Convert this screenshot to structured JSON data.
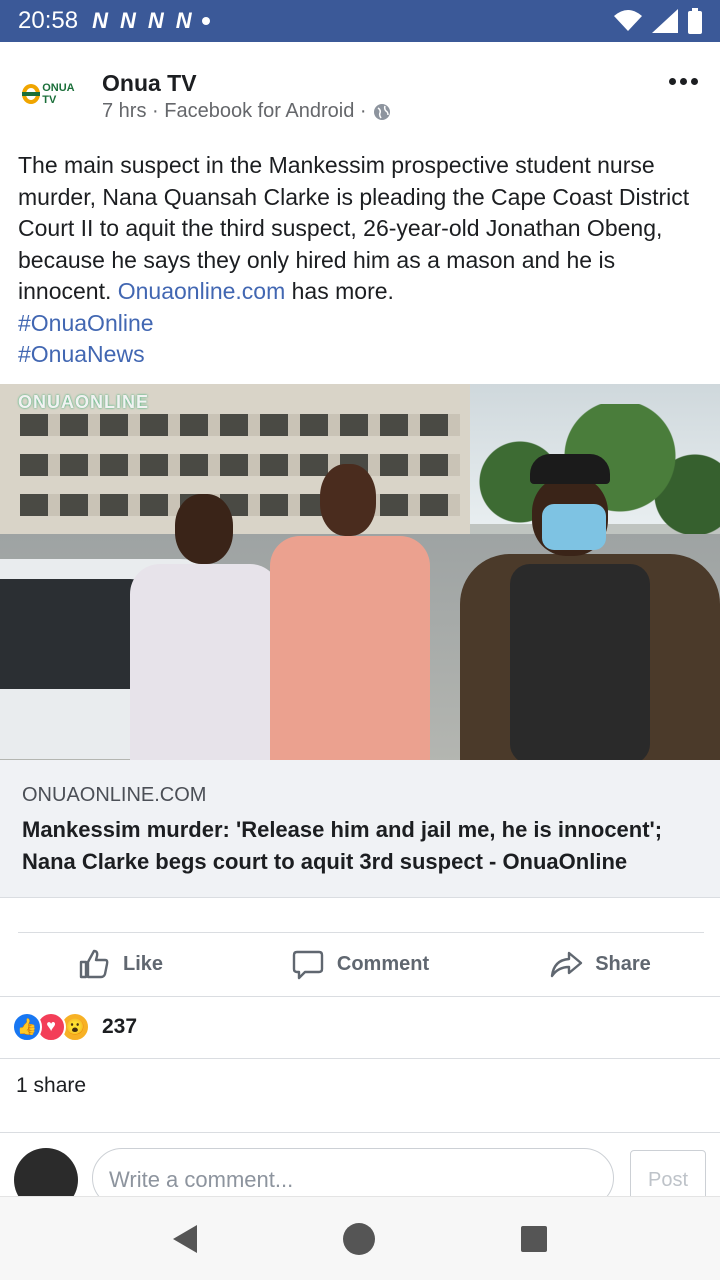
{
  "status_bar": {
    "time": "20:58",
    "notification_icons": [
      "N",
      "N",
      "N",
      "N"
    ],
    "icons": [
      "wifi-icon",
      "signal-icon",
      "battery-icon"
    ],
    "background": "#3b5998"
  },
  "post": {
    "page_name": "Onua TV",
    "logo_text": "ONUA TV",
    "meta": "7 hrs · Facebook for Android ·",
    "text_main": "The main suspect in the Mankessim prospective student nurse murder, Nana Quansah Clarke is pleading the Cape Coast District Court II to aquit the third suspect, 26-year-old Jonathan Obeng, because he says they only hired him as a mason and he is innocent. ",
    "text_link": "Onuaonline.com",
    "text_tail": " has more.",
    "hashtags": [
      "#OnuaOnline",
      "#OnuaNews"
    ],
    "image_watermark": "ONUAONLINE",
    "link_preview": {
      "domain": "ONUAONLINE.COM",
      "title": "Mankessim murder: 'Release him and jail me, he is innocent'; Nana Clarke begs court to aquit 3rd suspect - OnuaOnline"
    }
  },
  "actions": {
    "like": "Like",
    "comment": "Comment",
    "share": "Share"
  },
  "reactions": {
    "count": "237",
    "types": [
      "like-icon",
      "love-icon",
      "wow-icon"
    ]
  },
  "shares": "1 share",
  "comment_box": {
    "placeholder": "Write a comment...",
    "post_button": "Post"
  },
  "colors": {
    "accent": "#4267b2",
    "brand": "#3b5998"
  }
}
